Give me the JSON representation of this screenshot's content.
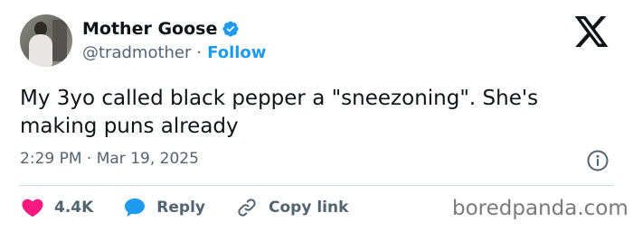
{
  "author": {
    "name": "Mother Goose",
    "handle": "@tradmother",
    "separator": "·",
    "follow_label": "Follow",
    "verified": true,
    "verified_color": "#1d9bf0"
  },
  "tweet": {
    "text": "My 3yo called black pepper a \"sneezoning\". She's\nmaking puns already",
    "timestamp": "2:29 PM · Mar 19, 2025"
  },
  "actions": {
    "like_count": "4.4K",
    "reply_label": "Reply",
    "copy_link_label": "Copy link"
  },
  "icons": {
    "brand": "x-logo-icon",
    "info": "info-icon",
    "like": "heart-icon",
    "reply": "speech-bubble-icon",
    "copy": "link-icon"
  },
  "colors": {
    "like": "#f91880",
    "reply": "#1d9bf0",
    "accent": "#1d9bf0",
    "muted": "#536471"
  },
  "watermark": "boredpanda.com"
}
